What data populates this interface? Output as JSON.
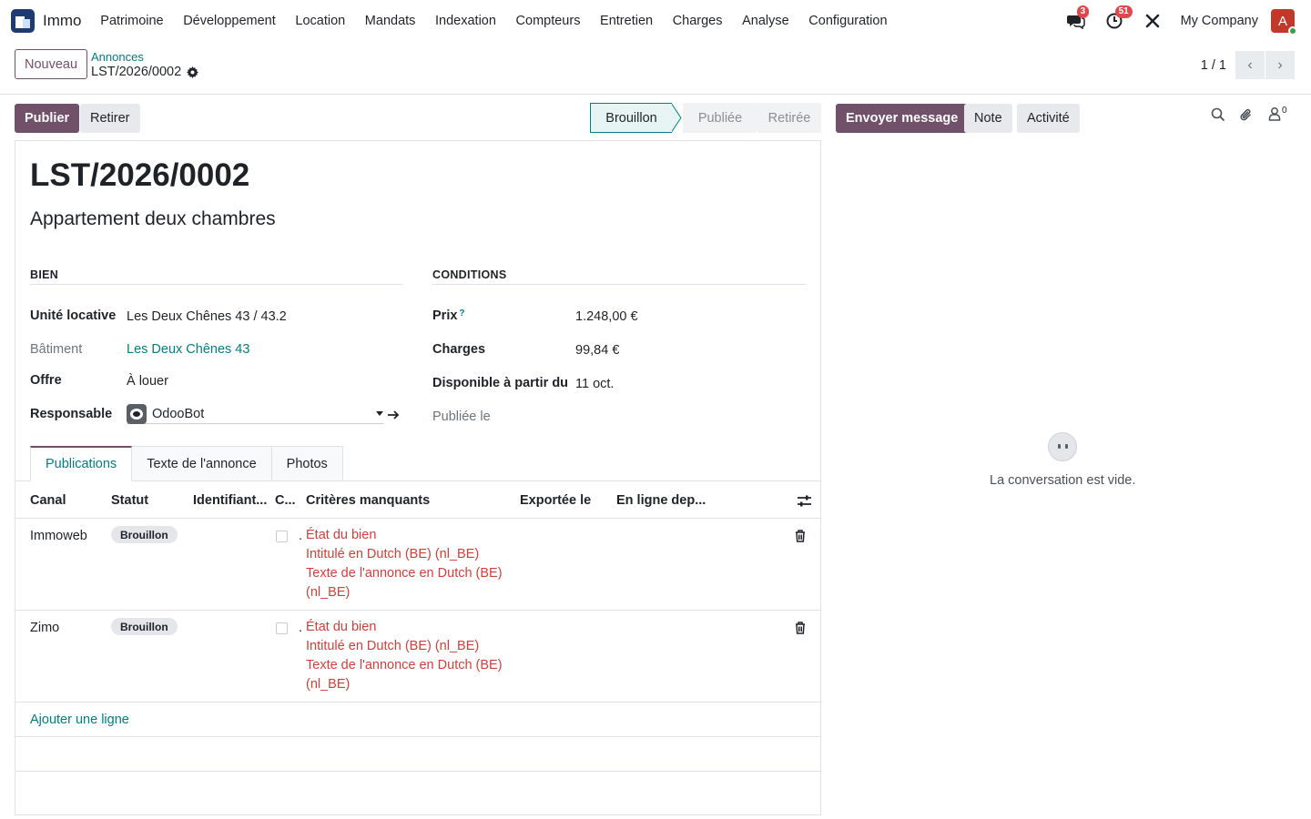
{
  "nav": {
    "app_name": "Immo",
    "menus": [
      "Patrimoine",
      "Développement",
      "Location",
      "Mandats",
      "Indexation",
      "Compteurs",
      "Entretien",
      "Charges",
      "Analyse",
      "Configuration"
    ],
    "messages_badge": "3",
    "activities_badge": "51",
    "company": "My Company",
    "avatar_letter": "A"
  },
  "control": {
    "new_button": "Nouveau",
    "breadcrumb": "Annonces",
    "record": "LST/2026/0002",
    "pager": "1 / 1"
  },
  "actions": {
    "publish": "Publier",
    "withdraw": "Retirer",
    "stages": [
      "Brouillon",
      "Publiée",
      "Retirée"
    ],
    "active_stage": "Brouillon",
    "send_message": "Envoyer message",
    "note": "Note",
    "activity": "Activité",
    "followers_count": "0"
  },
  "form": {
    "title": "LST/2026/0002",
    "subtitle": "Appartement deux chambres",
    "bien": {
      "heading": "BIEN",
      "unite_label": "Unité locative",
      "unite_value": "Les Deux Chênes 43 / 43.2",
      "batiment_label": "Bâtiment",
      "batiment_value": "Les Deux Chênes 43",
      "offre_label": "Offre",
      "offre_value": "À louer",
      "responsable_label": "Responsable",
      "responsable_value": "OdooBot"
    },
    "conditions": {
      "heading": "CONDITIONS",
      "prix_label": "Prix",
      "prix_help": "?",
      "prix_value": "1.248,00 €",
      "charges_label": "Charges",
      "charges_value": "99,84 €",
      "dispo_label": "Disponible à partir du",
      "dispo_value": "11 oct.",
      "publiee_label": "Publiée le"
    }
  },
  "tabs": [
    "Publications",
    "Texte de l'annonce",
    "Photos"
  ],
  "table": {
    "headers": [
      "Canal",
      "Statut",
      "Identifiant...",
      "C...",
      "Critères manquants",
      "Exportée le",
      "En ligne dep..."
    ],
    "rows": [
      {
        "canal": "Immoweb",
        "statut": "Brouillon",
        "prefix": ".",
        "criteres": [
          "État du bien",
          "Intitulé en Dutch (BE) (nl_BE)",
          "Texte de l'annonce en Dutch (BE)",
          "(nl_BE)"
        ]
      },
      {
        "canal": "Zimo",
        "statut": "Brouillon",
        "prefix": ".",
        "criteres": [
          "État du bien",
          "Intitulé en Dutch (BE) (nl_BE)",
          "Texte de l'annonce en Dutch (BE)",
          "(nl_BE)"
        ]
      }
    ],
    "add_line": "Ajouter une ligne"
  },
  "chatter": {
    "empty": "La conversation est vide."
  },
  "colors": {
    "primary": "#71506a",
    "link": "#017e84",
    "danger": "#d23f3a"
  }
}
